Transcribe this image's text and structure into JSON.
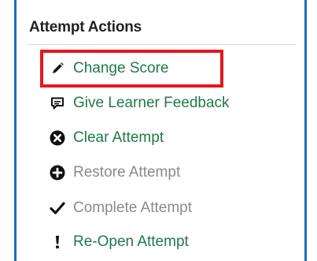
{
  "panel": {
    "title": "Attempt Actions"
  },
  "actions": [
    {
      "label": "Change Score",
      "icon": "pencil-icon",
      "state": "enabled",
      "highlighted": true
    },
    {
      "label": "Give Learner Feedback",
      "icon": "comment-icon",
      "state": "enabled"
    },
    {
      "label": "Clear Attempt",
      "icon": "x-circle-icon",
      "state": "enabled"
    },
    {
      "label": "Restore Attempt",
      "icon": "plus-circle-icon",
      "state": "disabled"
    },
    {
      "label": "Complete Attempt",
      "icon": "checkmark-icon",
      "state": "disabled"
    },
    {
      "label": "Re-Open Attempt",
      "icon": "exclamation-icon",
      "state": "enabled"
    }
  ],
  "colors": {
    "frame_border": "#1d6fb8",
    "highlight_border": "#e3171b",
    "enabled_link": "#1f7a4a",
    "disabled_link": "#8a8a8a",
    "title_text": "#222222"
  }
}
